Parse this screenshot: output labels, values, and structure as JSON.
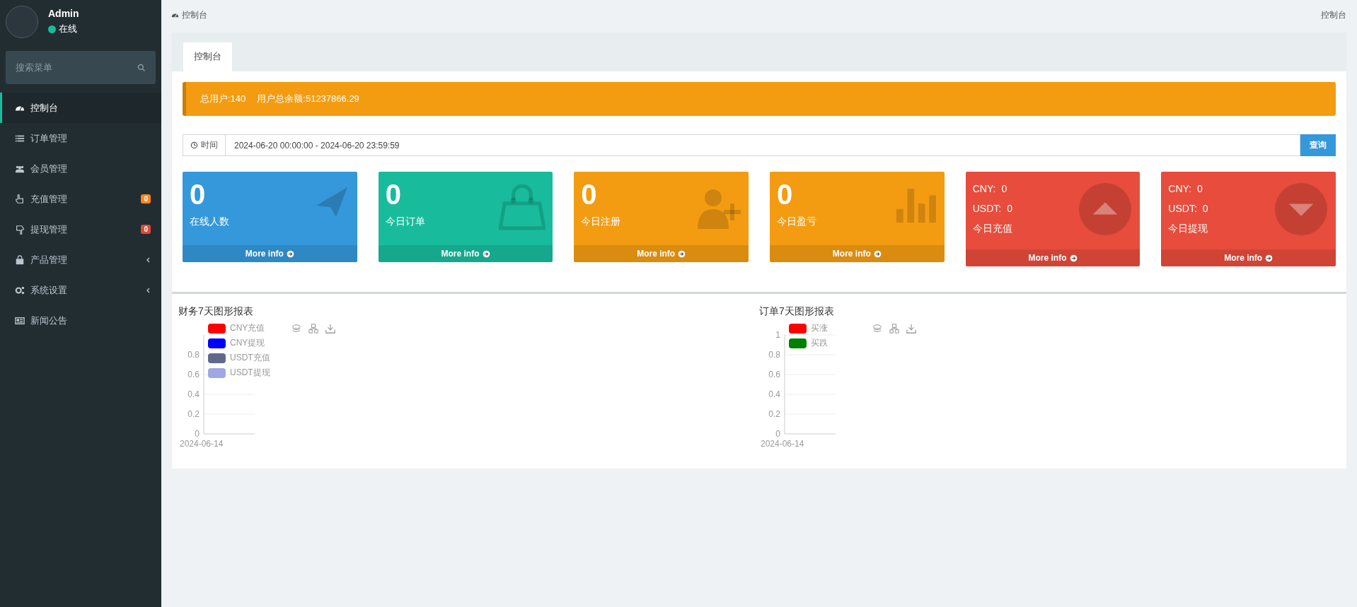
{
  "sidebar": {
    "user": {
      "name": "Admin",
      "status": "在线"
    },
    "search": {
      "placeholder": "搜索菜单"
    },
    "items": [
      {
        "label": "控制台",
        "selected": true,
        "has_submenu": false
      },
      {
        "label": "订单管理",
        "selected": false,
        "has_submenu": false
      },
      {
        "label": "会员管理",
        "selected": false,
        "has_submenu": false
      },
      {
        "label": "充值管理",
        "selected": false,
        "has_submenu": false,
        "badge": {
          "text": "0",
          "color": "#ff851b"
        }
      },
      {
        "label": "提现管理",
        "selected": false,
        "has_submenu": false,
        "badge": {
          "text": "0",
          "color": "#dd4b39"
        }
      },
      {
        "label": "产品管理",
        "selected": false,
        "has_submenu": true
      },
      {
        "label": "系统设置",
        "selected": false,
        "has_submenu": true
      },
      {
        "label": "新闻公告",
        "selected": false,
        "has_submenu": false
      }
    ]
  },
  "header": {
    "breadcrumb": "控制台",
    "page_title": "控制台"
  },
  "tabs": [
    {
      "label": "控制台",
      "selected": true
    }
  ],
  "alert": {
    "total_users": "总用户:140",
    "total_balance": "用户总余额:51237866.29"
  },
  "time_filter": {
    "label": "时间",
    "value": "2024-06-20 00:00:00 - 2024-06-20 23:59:59",
    "button": "查询"
  },
  "cards": [
    {
      "kind": "count",
      "value": "0",
      "label": "在线人数",
      "color": "#3498db",
      "footer": "More info"
    },
    {
      "kind": "count",
      "value": "0",
      "label": "今日订单",
      "color": "#18bc9c",
      "footer": "More info"
    },
    {
      "kind": "count",
      "value": "0",
      "label": "今日注册",
      "color": "#f39c12",
      "footer": "More info"
    },
    {
      "kind": "count",
      "value": "0",
      "label": "今日盈亏",
      "color": "#f39c12",
      "footer": "More info"
    },
    {
      "kind": "currency",
      "lines": [
        {
          "label": "CNY:",
          "value": "0"
        },
        {
          "label": "USDT:",
          "value": "0"
        }
      ],
      "label": "今日充值",
      "color": "#e74c3c",
      "footer": "More info"
    },
    {
      "kind": "currency",
      "lines": [
        {
          "label": "CNY:",
          "value": "0"
        },
        {
          "label": "USDT:",
          "value": "0"
        }
      ],
      "label": "今日提现",
      "color": "#e74c3c",
      "footer": "More info"
    }
  ],
  "charts": [
    {
      "chart_data": {
        "type": "line",
        "title": "财务7天图形报表",
        "categories": [
          "2024-06-14"
        ],
        "yticks": [
          0,
          0.2,
          0.4,
          0.6,
          0.8
        ],
        "ylim": [
          0,
          1
        ],
        "grid": true,
        "series": [
          {
            "name": "CNY充值",
            "color": "#ff0000",
            "values": [
              null
            ]
          },
          {
            "name": "CNY提现",
            "color": "#0000ff",
            "values": [
              null
            ]
          },
          {
            "name": "USDT充值",
            "color": "#61698b",
            "values": [
              null
            ]
          },
          {
            "name": "USDT提现",
            "color": "#9fa8e3",
            "values": [
              null
            ]
          }
        ]
      }
    },
    {
      "chart_data": {
        "type": "line",
        "title": "订单7天图形报表",
        "categories": [
          "2024-06-14"
        ],
        "yticks": [
          0,
          0.2,
          0.4,
          0.6,
          0.8,
          1
        ],
        "ylim": [
          0,
          1
        ],
        "grid": true,
        "series": [
          {
            "name": "买涨",
            "color": "#ff0000",
            "values": [
              null
            ]
          },
          {
            "name": "买跌",
            "color": "#008000",
            "values": [
              null
            ]
          }
        ]
      }
    }
  ]
}
